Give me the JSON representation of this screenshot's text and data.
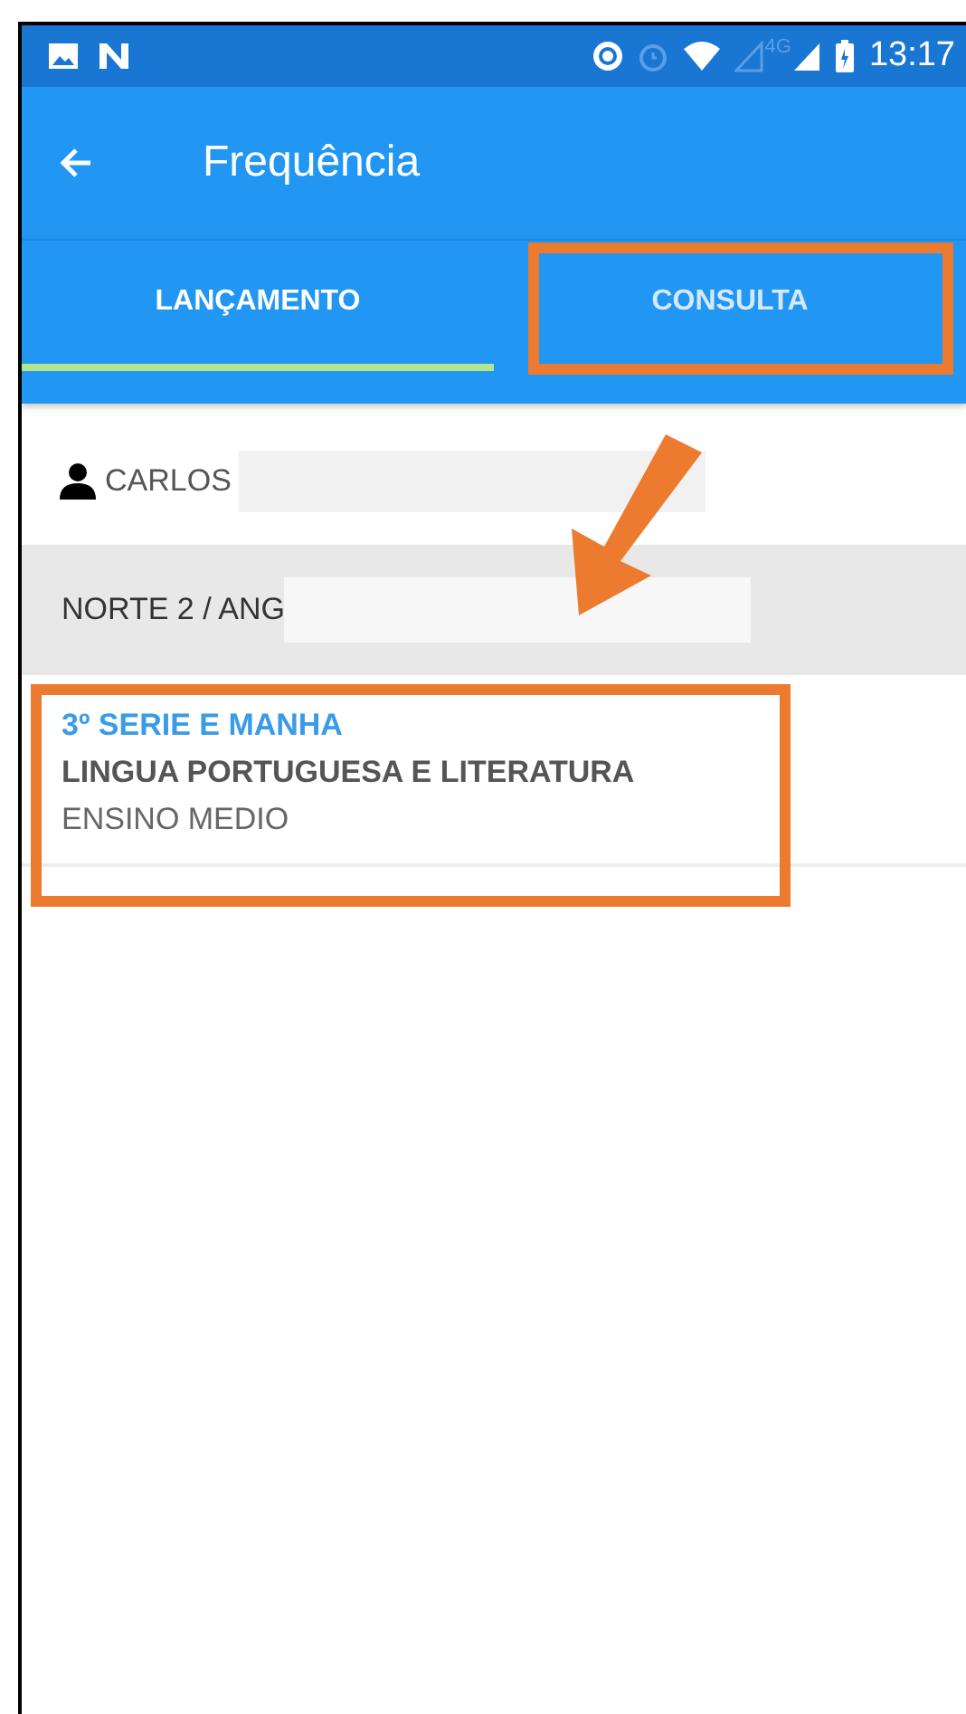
{
  "status_bar": {
    "network": "4G",
    "time": "13:17"
  },
  "toolbar": {
    "title": "Frequência"
  },
  "tabs": [
    {
      "label": "LANÇAMENTO",
      "selected": true
    },
    {
      "label": "CONSULTA",
      "selected": false
    }
  ],
  "user": {
    "name": "CARLOS",
    "redacted": true
  },
  "section": {
    "title": "NORTE 2 / ANG",
    "redacted": true
  },
  "items": [
    {
      "class": "3º SERIE E  MANHA",
      "subject": "LINGUA PORTUGUESA E LITERATURA",
      "level": "ENSINO MEDIO"
    }
  ],
  "annotations": [
    {
      "kind": "tab-box"
    },
    {
      "kind": "arrow"
    },
    {
      "kind": "item-box"
    }
  ]
}
